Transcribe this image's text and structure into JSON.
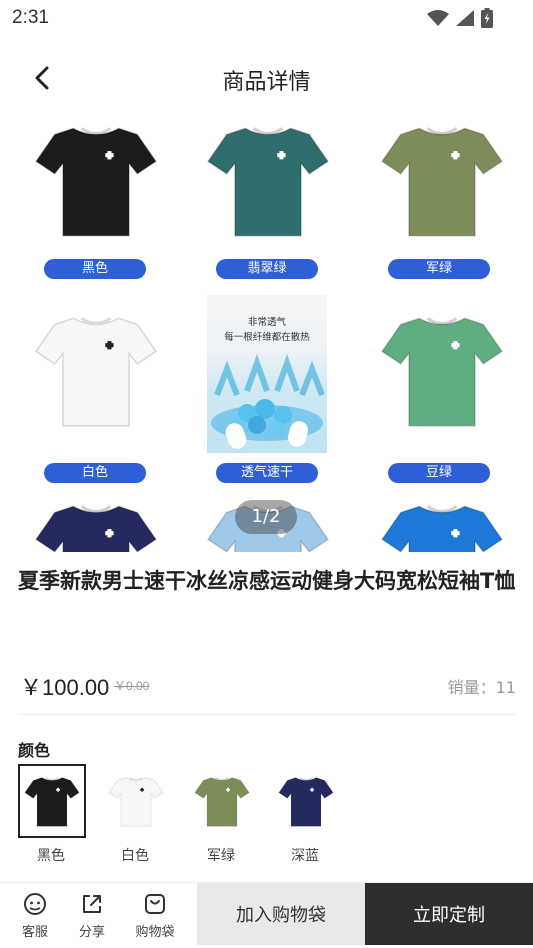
{
  "status_bar": {
    "time": "2:31"
  },
  "header": {
    "title": "商品详情"
  },
  "gallery": {
    "page_indicator": "1/2",
    "promo_text_line1": "非常透气",
    "promo_text_line2": "每一根纤维都在散热",
    "items": [
      {
        "label": "黑色",
        "color": "#1c1c1c"
      },
      {
        "label": "翡翠绿",
        "color": "#2f6e6c"
      },
      {
        "label": "军绿",
        "color": "#7d8d5a"
      },
      {
        "label": "白色",
        "color": "#f7f7f7"
      },
      {
        "label": "透气速干",
        "color": "#bfe3f1"
      },
      {
        "label": "豆绿",
        "color": "#5fae82"
      },
      {
        "label": "",
        "color": "#242a5e"
      },
      {
        "label": "",
        "color": "#9fc9ea"
      },
      {
        "label": "",
        "color": "#1e78d8"
      }
    ]
  },
  "product": {
    "title": "夏季新款男士速干冰丝凉感运动健身大码宽松短袖T恤",
    "price": "￥100.00",
    "original_price": "￥0.00",
    "sales": "销量：11"
  },
  "options": {
    "color_label": "颜色",
    "swatches": [
      {
        "name": "黑色",
        "color": "#1c1c1c",
        "selected": true
      },
      {
        "name": "白色",
        "color": "#f7f7f7",
        "selected": false
      },
      {
        "name": "军绿",
        "color": "#7d8d5a",
        "selected": false
      },
      {
        "name": "深蓝",
        "color": "#242a5e",
        "selected": false
      }
    ]
  },
  "bottom_bar": {
    "service_label": "客服",
    "share_label": "分享",
    "bag_label": "购物袋",
    "add_to_bag_label": "加入购物袋",
    "customize_label": "立即定制"
  }
}
